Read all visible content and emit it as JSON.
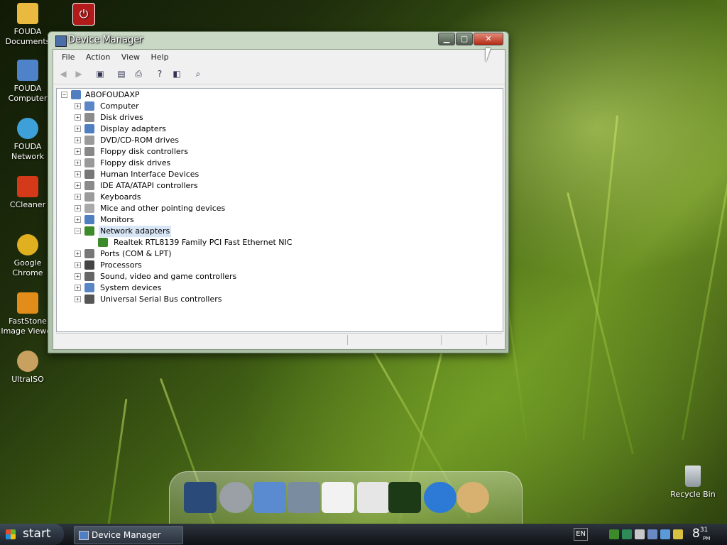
{
  "desktop": {
    "icons": [
      {
        "label": "FOUDA Documents",
        "line1": "FOUDA",
        "line2": "Documents",
        "icon": "folder-icon",
        "color": "#e9b940"
      },
      {
        "label": "FOUDA Computer",
        "line1": "FOUDA",
        "line2": "Computer",
        "icon": "computer-icon",
        "color": "#4f83c9"
      },
      {
        "label": "FOUDA Network",
        "line1": "FOUDA",
        "line2": "Network",
        "icon": "network-globe-icon",
        "color": "#3ea0d8"
      },
      {
        "label": "CCleaner",
        "line1": "CCleaner",
        "line2": "",
        "icon": "ccleaner-icon",
        "color": "#d43a1a"
      },
      {
        "label": "Google Chrome",
        "line1": "Google Chrome",
        "line2": "",
        "icon": "chrome-icon",
        "color": "#e0b020"
      },
      {
        "label": "FastStone Image Viewer",
        "line1": "FastStone",
        "line2": "Image Viewer",
        "icon": "eye-icon",
        "color": "#e28c1a"
      },
      {
        "label": "UltraISO",
        "line1": "UltraISO",
        "line2": "",
        "icon": "disc-icon",
        "color": "#c8a060"
      }
    ],
    "shutdown_icon": "power-icon",
    "recycle_bin": "Recycle Bin"
  },
  "window": {
    "title": "Device Manager",
    "menu": [
      "File",
      "Action",
      "View",
      "Help"
    ],
    "toolbar_icons": [
      "back-arrow-icon",
      "forward-arrow-icon",
      "show-hide-console-tree-icon",
      "properties-icon",
      "print-icon",
      "help-icon",
      "show-hide-action-pane-icon",
      "scan-hardware-icon"
    ],
    "tree": {
      "root": "ABOFOUDAXP",
      "categories": [
        {
          "label": "Computer",
          "icon": "computer-icon",
          "color": "#5b86c5"
        },
        {
          "label": "Disk drives",
          "icon": "disk-drive-icon",
          "color": "#8c8c8c"
        },
        {
          "label": "Display adapters",
          "icon": "display-adapter-icon",
          "color": "#4f7fc0"
        },
        {
          "label": "DVD/CD-ROM drives",
          "icon": "cdrom-icon",
          "color": "#9a9a9a"
        },
        {
          "label": "Floppy disk controllers",
          "icon": "floppy-controller-icon",
          "color": "#888"
        },
        {
          "label": "Floppy disk drives",
          "icon": "floppy-drive-icon",
          "color": "#999"
        },
        {
          "label": "Human Interface Devices",
          "icon": "hid-icon",
          "color": "#777"
        },
        {
          "label": "IDE ATA/ATAPI controllers",
          "icon": "ide-controller-icon",
          "color": "#8a8a8a"
        },
        {
          "label": "Keyboards",
          "icon": "keyboard-icon",
          "color": "#9b9b9b"
        },
        {
          "label": "Mice and other pointing devices",
          "icon": "mouse-icon",
          "color": "#aaa"
        },
        {
          "label": "Monitors",
          "icon": "monitor-icon",
          "color": "#4f7fc0"
        },
        {
          "label": "Network adapters",
          "icon": "network-adapter-icon",
          "color": "#3c8a2a",
          "expanded": true,
          "selected": true,
          "children": [
            {
              "label": "Realtek RTL8139 Family PCI Fast Ethernet NIC",
              "icon": "network-card-icon",
              "color": "#3c8a2a"
            }
          ]
        },
        {
          "label": "Ports (COM & LPT)",
          "icon": "port-icon",
          "color": "#777"
        },
        {
          "label": "Processors",
          "icon": "processor-icon",
          "color": "#444"
        },
        {
          "label": "Sound, video and game controllers",
          "icon": "speaker-icon",
          "color": "#666"
        },
        {
          "label": "System devices",
          "icon": "system-devices-icon",
          "color": "#5b86c5"
        },
        {
          "label": "Universal Serial Bus controllers",
          "icon": "usb-icon",
          "color": "#555"
        }
      ]
    }
  },
  "dock": {
    "items": [
      {
        "icon": "monitor-icon",
        "color": "#2a4a7a"
      },
      {
        "icon": "settings-gear-icon",
        "color": "#9aa0a6"
      },
      {
        "icon": "photo-folder-icon",
        "color": "#5a8ad0"
      },
      {
        "icon": "hard-drive-icon",
        "color": "#7a8ca0"
      },
      {
        "icon": "white-drive-icon",
        "color": "#f2f2f2"
      },
      {
        "icon": "recycle-bin-icon",
        "color": "#e6e6e6"
      },
      {
        "icon": "display-icon",
        "color": "#1c3a16"
      },
      {
        "icon": "internet-explorer-icon",
        "color": "#2d7ad6"
      },
      {
        "icon": "paint-palette-icon",
        "color": "#d8b070"
      }
    ]
  },
  "taskbar": {
    "start_label": "start",
    "active_task": "Device Manager",
    "language": "EN",
    "clock_hour": "8",
    "clock_minute": "31",
    "clock_ampm": "PM"
  }
}
